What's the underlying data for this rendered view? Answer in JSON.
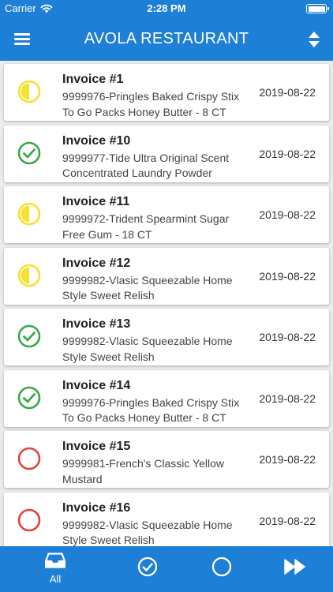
{
  "status_bar": {
    "carrier": "Carrier",
    "time": "2:28 PM"
  },
  "nav": {
    "title": "AVOLA RESTAURANT",
    "menu_icon": "hamburger-menu-icon",
    "sort_icon": "sort-updown-icon"
  },
  "colors": {
    "primary": "#1e7fd6",
    "pending": "#f5e130",
    "approved": "#3aa84a",
    "open": "#e0443b"
  },
  "invoices": [
    {
      "title": "Invoice #1",
      "desc": "9999976-Pringles Baked Crispy Stix To Go Packs Honey Butter - 8 CT",
      "date": "2019-08-22",
      "status": "pending"
    },
    {
      "title": "Invoice #10",
      "desc": "9999977-Tide Ultra Original Scent Concentrated Laundry Powder",
      "date": "2019-08-22",
      "status": "approved"
    },
    {
      "title": "Invoice #11",
      "desc": "9999972-Trident Spearmint Sugar Free Gum - 18 CT",
      "date": "2019-08-22",
      "status": "pending"
    },
    {
      "title": "Invoice #12",
      "desc": "9999982-Vlasic Squeezable Home Style Sweet Relish",
      "date": "2019-08-22",
      "status": "pending"
    },
    {
      "title": "Invoice #13",
      "desc": "9999982-Vlasic Squeezable Home Style Sweet Relish",
      "date": "2019-08-22",
      "status": "approved"
    },
    {
      "title": "Invoice #14",
      "desc": "9999976-Pringles Baked Crispy Stix To Go Packs Honey Butter - 8 CT",
      "date": "2019-08-22",
      "status": "approved"
    },
    {
      "title": "Invoice #15",
      "desc": "9999981-French's Classic Yellow Mustard",
      "date": "2019-08-22",
      "status": "open"
    },
    {
      "title": "Invoice #16",
      "desc": "9999982-Vlasic Squeezable Home Style Sweet Relish",
      "date": "2019-08-22",
      "status": "open"
    }
  ],
  "tabs": [
    {
      "label": "All",
      "icon": "inbox-tray-icon",
      "active": true
    },
    {
      "label": "",
      "icon": "check-circle-icon"
    },
    {
      "label": "",
      "icon": "empty-circle-icon"
    },
    {
      "label": "",
      "icon": "fast-forward-icon"
    }
  ]
}
